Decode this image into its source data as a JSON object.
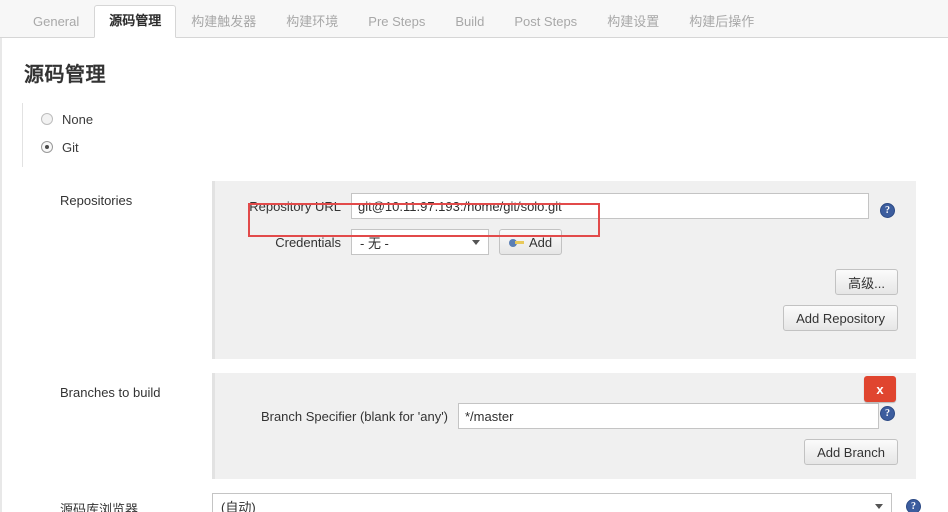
{
  "tabs": [
    {
      "label": "General",
      "active": false
    },
    {
      "label": "源码管理",
      "active": true
    },
    {
      "label": "构建触发器",
      "active": false
    },
    {
      "label": "构建环境",
      "active": false
    },
    {
      "label": "Pre Steps",
      "active": false
    },
    {
      "label": "Build",
      "active": false
    },
    {
      "label": "Post Steps",
      "active": false
    },
    {
      "label": "构建设置",
      "active": false
    },
    {
      "label": "构建后操作",
      "active": false
    }
  ],
  "page": {
    "title": "源码管理"
  },
  "scm_options": [
    {
      "label": "None",
      "selected": false
    },
    {
      "label": "Git",
      "selected": true
    }
  ],
  "repositories": {
    "row_label": "Repositories",
    "repository_url": {
      "label": "Repository URL",
      "value": "git@10.11.97.193:/home/git/solo.git",
      "placeholder": ""
    },
    "credentials": {
      "label": "Credentials",
      "value": "- 无 -",
      "add_button": "Add"
    },
    "advanced_button": "高级...",
    "add_repository_button": "Add Repository"
  },
  "branches": {
    "row_label": "Branches to build",
    "branch_specifier": {
      "label": "Branch Specifier (blank for 'any')",
      "value": "*/master",
      "placeholder": ""
    },
    "delete_button": "x",
    "add_branch_button": "Add Branch"
  },
  "repository_browser": {
    "row_label": "源码库浏览器",
    "value": "(自动)"
  },
  "help_icon_glyph": "?",
  "colors": {
    "accent_red": "#e24a4a",
    "delete_red": "#e0452f",
    "help_blue": "#3c5d9e",
    "panel_gray": "#f0f0f0"
  }
}
